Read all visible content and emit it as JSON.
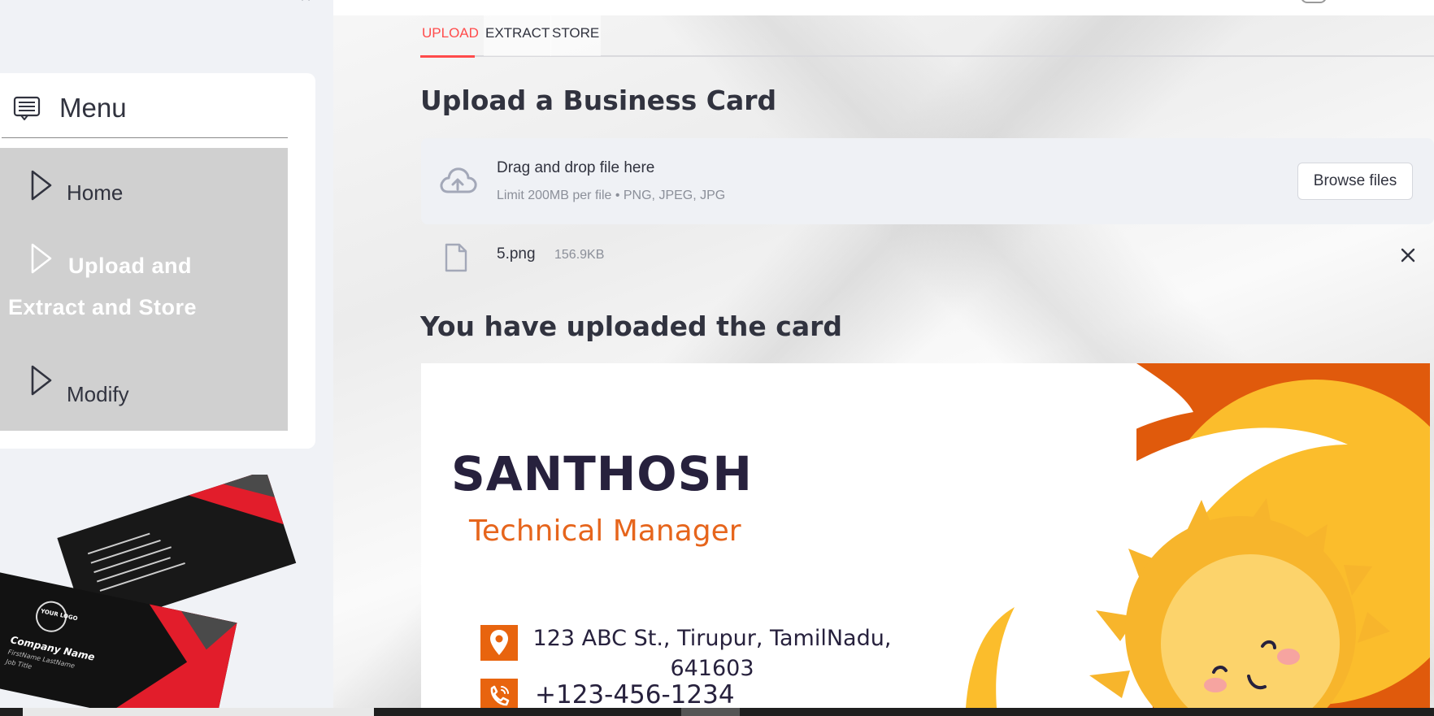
{
  "sidebar": {
    "menu_title": "Menu",
    "items": [
      {
        "label": "Home"
      },
      {
        "label_line1": "Upload and",
        "label_line2": "Extract and Store"
      },
      {
        "label": "Modify"
      }
    ],
    "image_card": {
      "logo_text": "YOUR LOGO",
      "company_name": "Company Name",
      "person_name": "FirstName LastName",
      "job_title": "Job Title"
    }
  },
  "main": {
    "tabs": [
      {
        "label": "UPLOAD",
        "active": true
      },
      {
        "label": "EXTRACT",
        "active": false
      },
      {
        "label": "STORE",
        "active": false
      }
    ],
    "upload_heading": "Upload a Business Card",
    "dropzone": {
      "title": "Drag and drop file here",
      "subtitle": "Limit 200MB per file • PNG, JPEG, JPG",
      "button_label": "Browse files"
    },
    "file": {
      "name": "5.png",
      "size": "156.9KB"
    },
    "uploaded_heading": "You have uploaded the card",
    "card": {
      "name": "SANTHOSH",
      "title": "Technical Manager",
      "address_line1": "123 ABC St., Tirupur, TamilNadu,",
      "address_line2": "641603",
      "phone": "+123-456-1234"
    }
  },
  "colors": {
    "accent": "#ff4b4b",
    "sidebar_bg": "#f0f2f6",
    "menu_list_bg": "#d0d0d0",
    "card_orange": "#e8640e",
    "card_navy": "#27213d",
    "sun_yellow": "#fbbd2c"
  },
  "icons": {
    "menu": "menu-icon",
    "menu_item": "play-outline-icon",
    "upload": "cloud-upload-icon",
    "file": "file-icon",
    "remove": "close-icon",
    "collapse": "close-icon"
  }
}
